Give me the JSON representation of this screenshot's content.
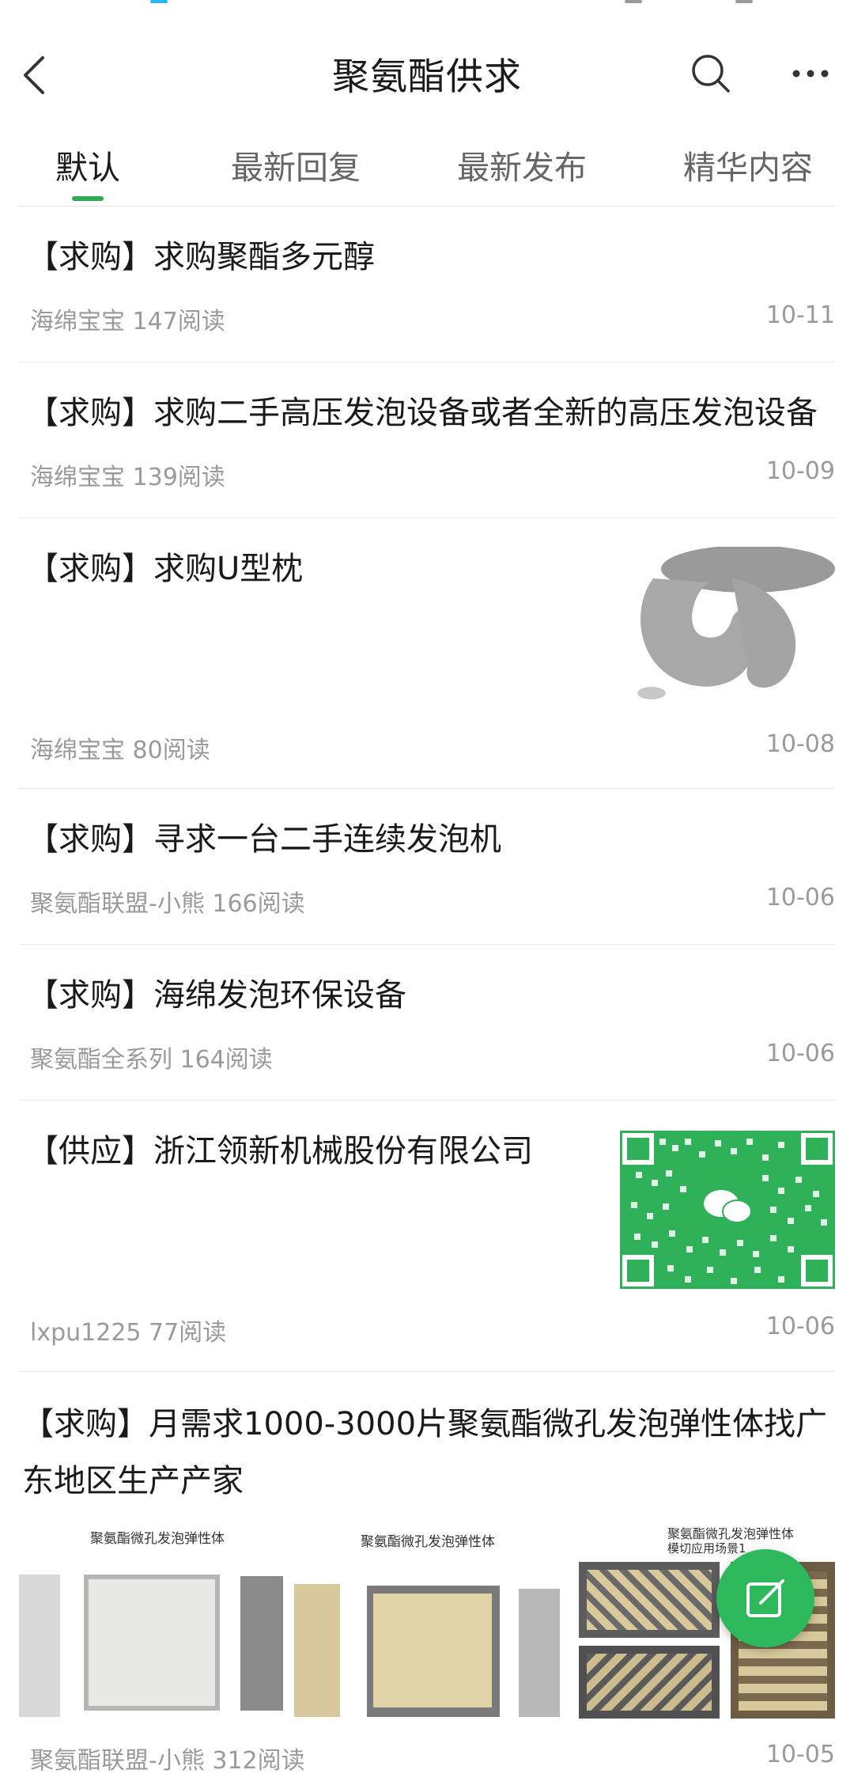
{
  "header": {
    "title": "聚氨酯供求"
  },
  "tabs": [
    {
      "label": "默认"
    },
    {
      "label": "最新回复"
    },
    {
      "label": "最新发布"
    },
    {
      "label": "精华内容"
    }
  ],
  "posts": [
    {
      "title": "【求购】求购聚酯多元醇",
      "author": "海绵宝宝",
      "reads": "147阅读",
      "date": "10-11"
    },
    {
      "title": "【求购】求购二手高压发泡设备或者全新的高压发泡设备",
      "author": "海绵宝宝",
      "reads": "139阅读",
      "date": "10-09"
    },
    {
      "title": "【求购】求购U型枕",
      "author": "海绵宝宝",
      "reads": "80阅读",
      "date": "10-08"
    },
    {
      "title": "【求购】寻求一台二手连续发泡机",
      "author": "聚氨酯联盟-小熊",
      "reads": "166阅读",
      "date": "10-06"
    },
    {
      "title": "【求购】海绵发泡环保设备",
      "author": "聚氨酯全系列",
      "reads": "164阅读",
      "date": "10-06"
    },
    {
      "title": "【供应】浙江领新机械股份有限公司",
      "author": "lxpu1225",
      "reads": "77阅读",
      "date": "10-06"
    },
    {
      "title": "【求购】月需求1000-3000片聚氨酯微孔发泡弹性体找广东地区生产产家",
      "author": "聚氨酯联盟-小熊",
      "reads": "312阅读",
      "date": "10-05"
    }
  ],
  "gallery": {
    "captions": [
      "聚氨酯微孔发泡弹性体",
      "聚氨酯微孔发泡弹性体",
      "聚氨酯微孔发泡弹性体",
      "模切应用场景1"
    ]
  },
  "colors": {
    "accent": "#2eaa52",
    "fab": "#2eb85c",
    "qr": "#2fb15a"
  },
  "icons": {
    "back": "chevron-left-icon",
    "search": "search-icon",
    "more": "more-dots-icon",
    "fab": "edit-icon"
  }
}
